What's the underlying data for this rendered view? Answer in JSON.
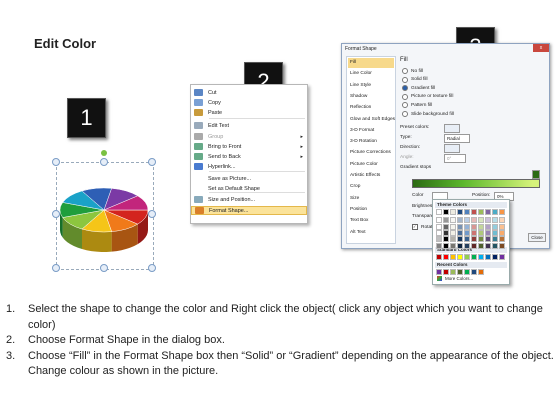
{
  "page": {
    "title": "Edit Color"
  },
  "badges": [
    "1",
    "2",
    "3"
  ],
  "context_menu": {
    "items": [
      {
        "label": "Cut",
        "icon": "scissors-icon",
        "submenu": false
      },
      {
        "label": "Copy",
        "icon": "copy-icon",
        "submenu": false
      },
      {
        "label": "Paste",
        "icon": "paste-icon",
        "submenu": false
      },
      {
        "label": "Edit Text",
        "icon": "edit-text-icon",
        "submenu": false
      },
      {
        "label": "Group",
        "icon": "group-icon",
        "submenu": true
      },
      {
        "label": "Bring to Front",
        "icon": "bring-front-icon",
        "submenu": true
      },
      {
        "label": "Send to Back",
        "icon": "send-back-icon",
        "submenu": true
      },
      {
        "label": "Hyperlink...",
        "icon": "hyperlink-icon",
        "submenu": false
      },
      {
        "label": "Save as Picture...",
        "icon": "",
        "submenu": false
      },
      {
        "label": "Set as Default Shape",
        "icon": "",
        "submenu": false
      },
      {
        "label": "Size and Position...",
        "icon": "size-icon",
        "submenu": false
      },
      {
        "label": "Format Shape...",
        "icon": "format-shape-icon",
        "submenu": false
      }
    ]
  },
  "dialog": {
    "title": "Format Shape",
    "close": "x",
    "nav": [
      "Fill",
      "Line Color",
      "Line Style",
      "Shadow",
      "Reflection",
      "Glow and Soft Edges",
      "3-D Format",
      "3-D Rotation",
      "Picture Corrections",
      "Picture Color",
      "Artistic Effects",
      "Crop",
      "Size",
      "Position",
      "Text Box",
      "Alt Text"
    ],
    "section": "Fill",
    "fill_options": [
      "No fill",
      "Solid fill",
      "Gradient fill",
      "Picture or texture fill",
      "Pattern fill",
      "Slide background fill"
    ],
    "selected_fill": "Gradient fill",
    "preset_label": "Preset colors:",
    "type_label": "Type:",
    "type_value": "Radial",
    "direction_label": "Direction:",
    "angle_label": "Angle:",
    "angle_value": "0°",
    "stops_label": "Gradient stops",
    "color_label": "Color",
    "position_label": "Position:",
    "position_value": "0%",
    "brightness_label": "Brightness:",
    "transparency_label": "Transparency:",
    "rotate_label": "Rotate with shape",
    "close_button": "Close"
  },
  "palette": {
    "theme_label": "Theme Colors",
    "standard_label": "Standard Colors",
    "recent_label": "Recent Colors",
    "more_label": "More Colors...",
    "theme_top": [
      "#ffffff",
      "#000000",
      "#eeece1",
      "#1f497d",
      "#4f81bd",
      "#c0504d",
      "#9bbb59",
      "#8064a2",
      "#4bacc6",
      "#f79646"
    ],
    "standard": [
      "#c00000",
      "#ff0000",
      "#ffc000",
      "#ffff00",
      "#92d050",
      "#00b050",
      "#00b0f0",
      "#0070c0",
      "#002060",
      "#7030a0"
    ],
    "recent": [
      "#7030a0",
      "#c00000",
      "#9bbb59",
      "#4f6228",
      "#00b050",
      "#1f497d",
      "#e36c09"
    ]
  },
  "instructions": [
    {
      "num": "1.",
      "text": "Select the shape to change the color and Right click the object( click any object which you want to change color)"
    },
    {
      "num": "2.",
      "text": "Choose Format Shape in the dialog box."
    },
    {
      "num": "3.",
      "text": "Choose “Fill” in the Format Shape box then “Solid” or “Gradient” depending on the appearance of the object. Change colour as shown in the picture."
    }
  ],
  "pie_colors": [
    "#d3241e",
    "#f07a1a",
    "#f5c518",
    "#8cc63f",
    "#1f9e3c",
    "#1aa2c8",
    "#2e5fb5",
    "#7b3aa5",
    "#c2257c"
  ]
}
